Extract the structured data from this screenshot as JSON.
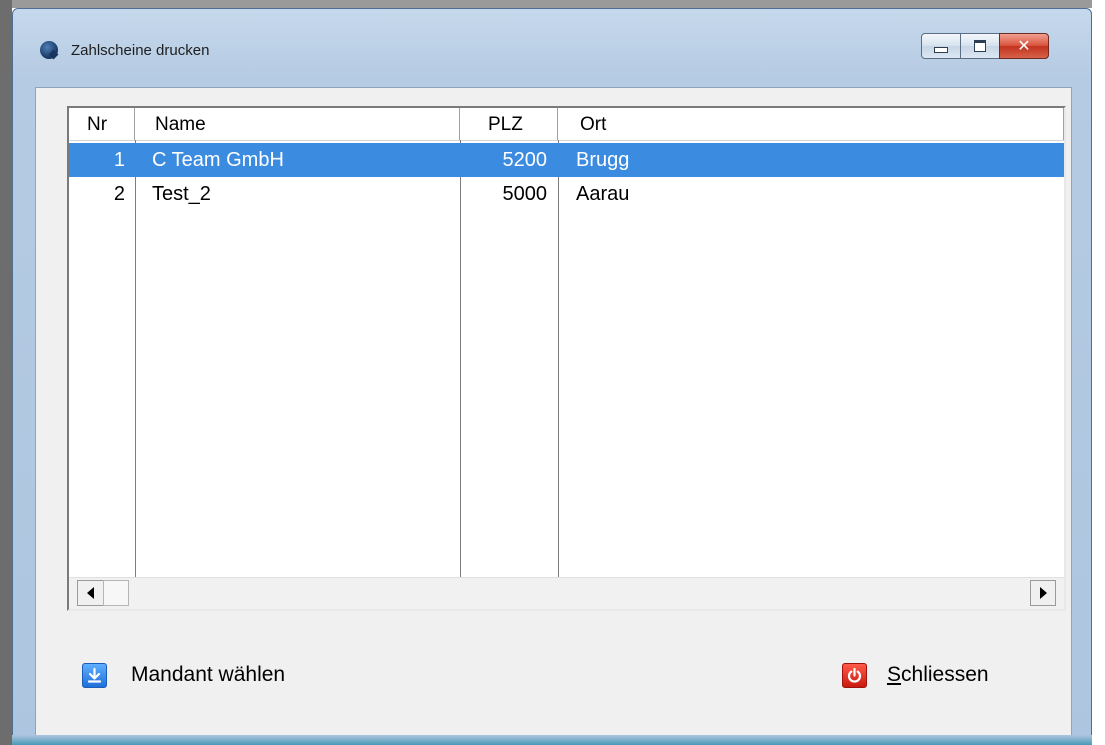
{
  "window": {
    "title": "Zahlscheine drucken",
    "minimize_label": "minimize",
    "maximize_label": "maximize",
    "close_label": "close"
  },
  "list": {
    "columns": [
      "Nr",
      "Name",
      "PLZ",
      "Ort"
    ],
    "rows": [
      {
        "nr": "1",
        "name": "C Team GmbH",
        "plz": "5200",
        "ort": "Brugg",
        "selected": true
      },
      {
        "nr": "2",
        "name": "Test_2",
        "plz": "5000",
        "ort": "Aarau",
        "selected": false
      }
    ]
  },
  "buttons": {
    "mandant_label": "Mandant wählen",
    "mandant_icon": "download-arrow-icon",
    "close_first_letter": "S",
    "close_rest": "chliessen",
    "close_icon": "power-icon"
  },
  "colors": {
    "selection": "#3b8be0",
    "frame": "#b5cbe3",
    "close_button": "#c2321e"
  }
}
